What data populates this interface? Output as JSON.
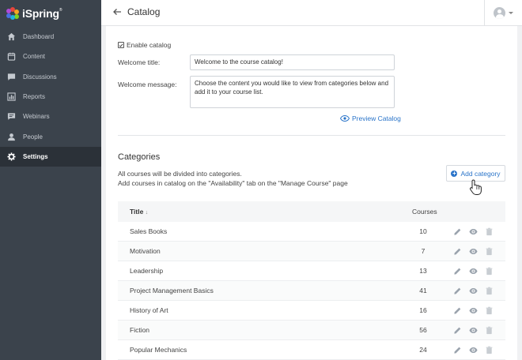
{
  "app": {
    "logo_text": "iSpring",
    "logo_mark": "®"
  },
  "sidebar": {
    "items": [
      {
        "label": "Dashboard",
        "icon": "home-icon"
      },
      {
        "label": "Content",
        "icon": "content-icon"
      },
      {
        "label": "Discussions",
        "icon": "discussions-icon"
      },
      {
        "label": "Reports",
        "icon": "reports-icon"
      },
      {
        "label": "Webinars",
        "icon": "webinars-icon"
      },
      {
        "label": "People",
        "icon": "people-icon"
      },
      {
        "label": "Settings",
        "icon": "gear-icon",
        "active": true
      }
    ]
  },
  "header": {
    "title": "Catalog"
  },
  "catalog_settings": {
    "enable_label": "Enable catalog",
    "enabled": true,
    "welcome_title_label": "Welcome title:",
    "welcome_title_value": "Welcome to the course catalog!",
    "welcome_message_label": "Welcome message:",
    "welcome_message_value": "Choose the content you would like to view from categories below and add it to your course list.",
    "preview_label": "Preview Catalog"
  },
  "categories": {
    "title": "Categories",
    "desc_line1": "All courses will be divided into categories.",
    "desc_line2": "Add courses in catalog on the \"Availability\" tab on the \"Manage Course\" page",
    "add_label": "Add category",
    "columns": {
      "title": "Title",
      "sort_indicator": "↓",
      "courses": "Courses"
    },
    "rows": [
      {
        "title": "Sales Books",
        "courses": "10"
      },
      {
        "title": "Motivation",
        "courses": "7"
      },
      {
        "title": "Leadership",
        "courses": "13"
      },
      {
        "title": "Project Management Basics",
        "courses": "41"
      },
      {
        "title": "History of Art",
        "courses": "16"
      },
      {
        "title": "Fiction",
        "courses": "56"
      },
      {
        "title": "Popular Mechanics",
        "courses": "24"
      }
    ]
  },
  "colors": {
    "sidebar_bg": "#3b434c",
    "sidebar_active": "#2b3138",
    "accent": "#2a74c9",
    "action_icon": "#9aa3ad"
  }
}
